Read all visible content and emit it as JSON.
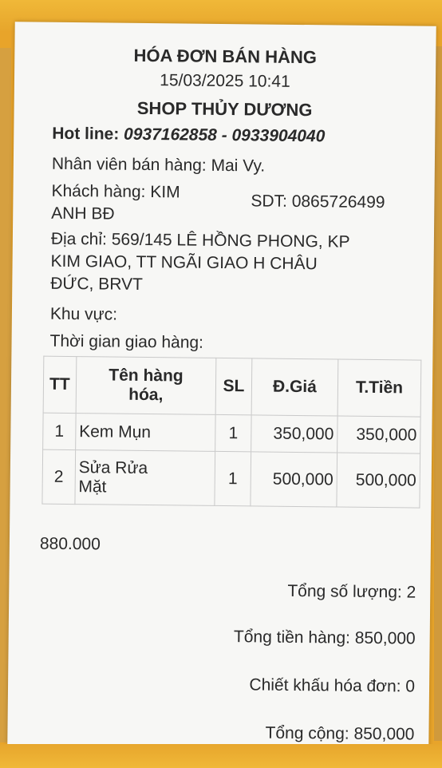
{
  "receipt": {
    "title": "HÓA ĐƠN BÁN HÀNG",
    "datetime": "15/03/2025 10:41",
    "shop": "SHOP THỦY DƯƠNG",
    "hotline_label": "Hot line:",
    "hotline_value": "0937162858 - 0933904040",
    "staff": "Nhân viên bán hàng: Mai Vy.",
    "customer_line1": "Khách hàng: KIM",
    "customer_line2": "ANH BĐ",
    "phone": "SDT: 0865726499",
    "address_line1": "Địa chỉ: 569/145 LÊ HỒNG PHONG, KP",
    "address_line2": "KIM GIAO, TT NGÃI GIAO H CHÂU",
    "address_line3": "ĐỨC, BRVT",
    "area": "Khu vực:",
    "delivery_time": "Thời gian giao hàng:",
    "table": {
      "headers": {
        "tt": "TT",
        "name_1": "Tên hàng",
        "name_2": "hóa,",
        "qty": "SL",
        "price": "Đ.Giá",
        "total": "T.Tiền"
      },
      "rows": [
        {
          "tt": "1",
          "name_1": "Kem Mụn",
          "name_2": "",
          "qty": "1",
          "price": "350,000",
          "total": "350,000"
        },
        {
          "tt": "2",
          "name_1": "Sửa Rửa",
          "name_2": "Mặt",
          "qty": "1",
          "price": "500,000",
          "total": "500,000"
        }
      ]
    },
    "note": "880.000",
    "total_qty": "Tổng số lượng: 2",
    "goods_total": "Tổng tiền hàng: 850,000",
    "discount": "Chiết khấu hóa đơn: 0",
    "grand_total": "Tổng cộng: 850,000"
  },
  "colors": {
    "background": "#e8a42a",
    "paper": "#f7f7f5",
    "text": "#2a2a2a"
  }
}
